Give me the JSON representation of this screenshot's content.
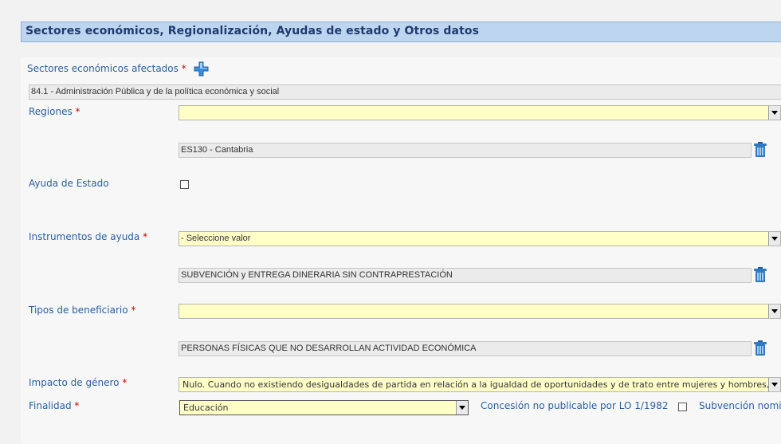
{
  "section": {
    "title": "Sectores económicos, Regionalización, Ayudas de estado y Otros datos"
  },
  "sectores": {
    "label": "Sectores económicos afectados",
    "required": "*",
    "value": "84.1 - Administración Pública y de la política económica y social"
  },
  "regiones": {
    "label": "Regiones",
    "required": "*",
    "select_value": "",
    "item": "ES130 - Cantabria"
  },
  "ayuda_estado": {
    "label": "Ayuda de Estado",
    "checked": false
  },
  "instrumentos": {
    "label": "Instrumentos de ayuda",
    "required": "*",
    "select_value": "- Seleccione valor",
    "item": "SUBVENCIÓN y ENTREGA DINERARIA SIN CONTRAPRESTACIÓN"
  },
  "beneficiario": {
    "label": "Tipos de beneficiario",
    "required": "*",
    "select_value": "",
    "item": "PERSONAS FÍSICAS QUE NO DESARROLLAN ACTIVIDAD ECONÓMICA"
  },
  "impacto": {
    "label": "Impacto de género",
    "required": "*",
    "select_value": "Nulo. Cuando no existiendo desigualdades de partida en relación a la igualdad de oportunidades y de trato entre mujeres y hombres, no"
  },
  "finalidad": {
    "label": "Finalidad",
    "required": "*",
    "select_value": "Educación",
    "concesion_label": "Concesión no publicable por LO 1/1982",
    "subvencion_label": "Subvención nomi"
  },
  "icons": {
    "add": "plus-icon",
    "delete": "trash-icon"
  },
  "colors": {
    "header_bg": "#bed5f0",
    "label_blue": "#2a5fa0",
    "field_yellow": "#ffffc6",
    "required_red": "#d00000"
  }
}
